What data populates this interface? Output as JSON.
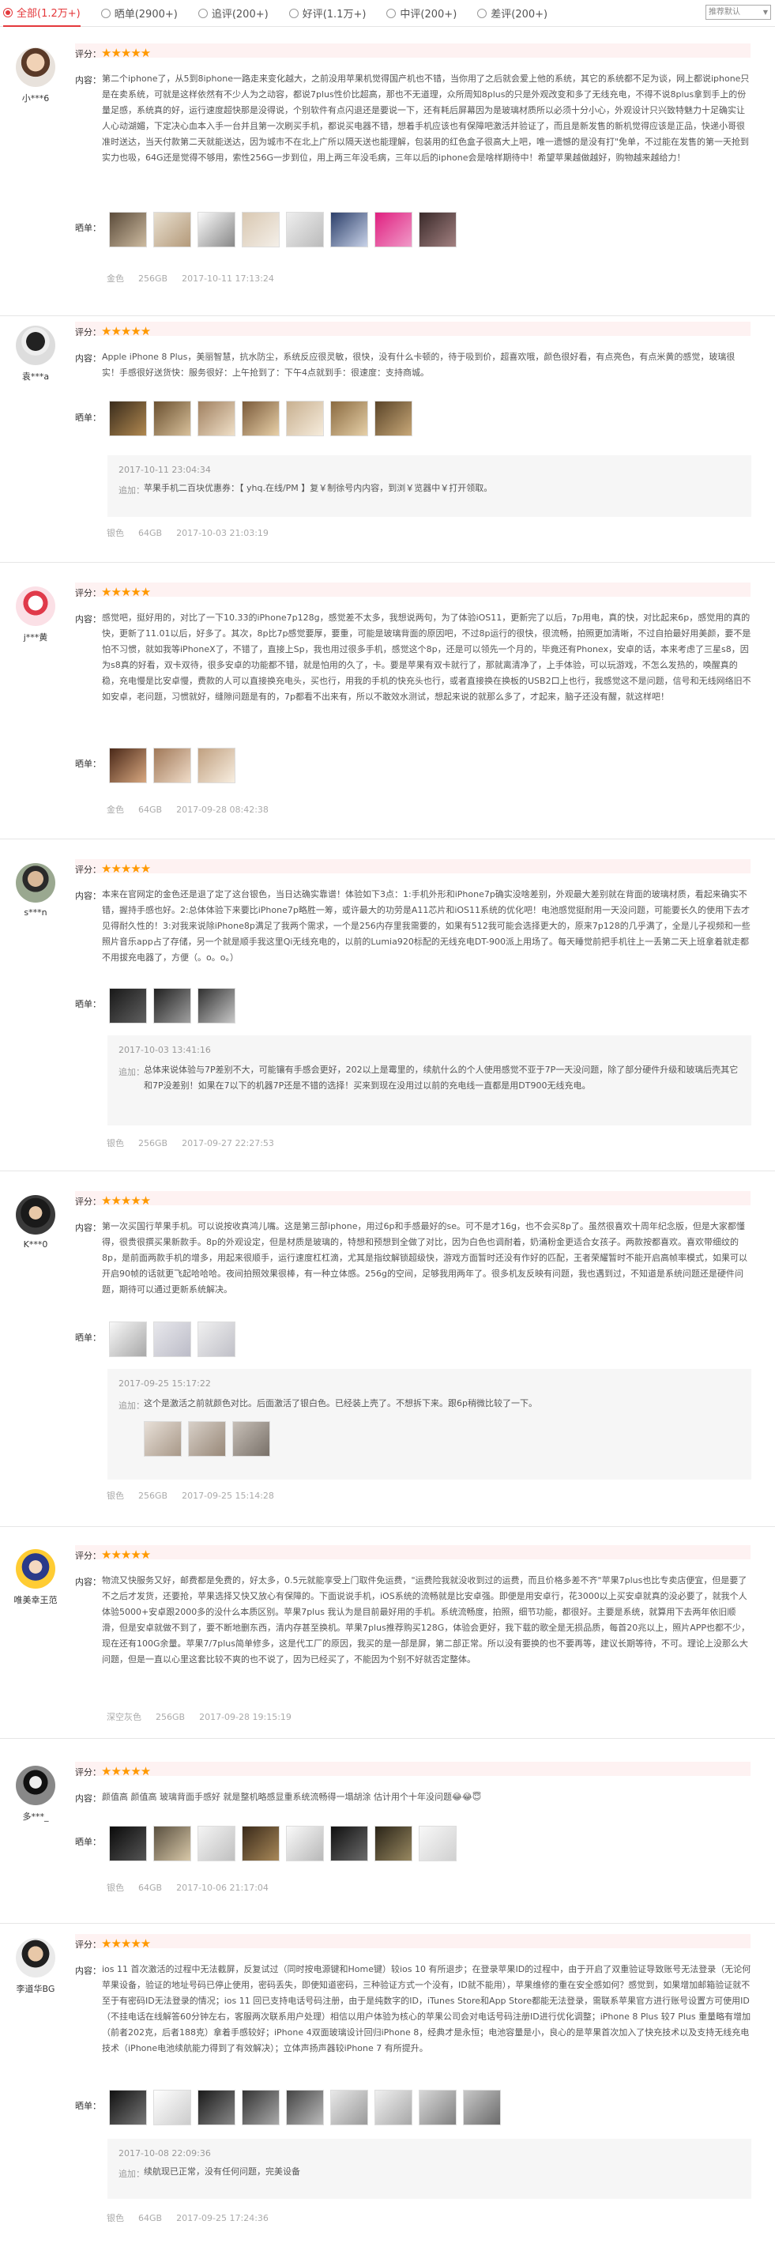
{
  "filter": {
    "tabs": [
      {
        "label": "全部(1.2万+)"
      },
      {
        "label": "晒单(2900+)"
      },
      {
        "label": "追评(200+)"
      },
      {
        "label": "好评(1.1万+)"
      },
      {
        "label": "中评(200+)"
      },
      {
        "label": "差评(200+)"
      }
    ],
    "sort_value": "推荐默认"
  },
  "labels": {
    "rating": "评分：",
    "content": "内容：",
    "photos": "晒单：",
    "append": "追加："
  },
  "stars": "★★★★★",
  "reviews": [
    {
      "user": "小***6",
      "text": "第二个iphone了，从5到8iphone一路走来变化越大，之前没用苹果机觉得国产机也不错，当你用了之后就会爱上他的系统，其它的系统都不足为谈，网上都说iphone只是在卖系统，可就是这样依然有不少人为之动容，都说7plus性价比超高，那也不无道理，众所周知8plus的只是外观改变和多了无线充电，不得不说8plus拿到手上的份量足感，系统真的好，运行速度超快那是没得说，个别软件有点闪退还是要说一下，还有耗后屏幕因为是玻璃材质所以必须十分小心，外观设计只兴致特魅力十足确实让人心动湖媚，下定决心血本入手一台并且第一次刷买手机，都说买电器不错，想着手机应该也有保障吧激活并验证了，而且是新发售的新机觉得应该是正品，快递小哥很准时送达，当天付款第二天就能送达，因为城市不在北上广所以隔天送也能理解，包装用的红色盒子很高大上吧，唯一遗憾的是没有打\"免单，不过能在发售的第一天抢到实力也吸，64G还是觉得不够用，索性256G一步到位，用上两三年没毛病，三年以后的iphone会是啥样期待中！希望苹果越做越好，购物越来越给力！",
      "meta": [
        "金色",
        "256GB",
        "2017-10-11 17:13:24"
      ]
    },
    {
      "user": "袁***a",
      "text": "Apple iPhone 8 Plus，美丽智慧，抗水防尘，系统反应很灵敏，很快，没有什么卡顿的，待于吸到价，超喜欢哦，颜色很好看，有点亮色，有点米黄的感觉，玻璃很实！手感很好送货快：服务很好：上午抢到了：下午4点就到手：很速度：支持商城。",
      "append_date": "2017-10-11 23:04:34",
      "append_text": "苹果手机二百块优惠券：【 yhq.在线/PM 】复￥制徐号内内容，到浏￥览器中￥打开领取。",
      "meta": [
        "银色",
        "64GB",
        "2017-10-03 21:03:19"
      ]
    },
    {
      "user": "j***黄",
      "text": "感觉吧，挺好用的，对比了一下10.33的iPhone7p128g，感觉差不太多，我想说两句，为了体验iOS11，更新完了以后，7p用电，真的快，对比起来6p，感觉用的真的快，更新了11.01以后，好多了。其次，8p比7p感觉要厚，要重，可能是玻璃背面的原因吧，不过8p运行的很快，很流畅，拍照更加清晰，不过自拍最好用美颜，要不是怕不习惯，就如我等iPhoneX了，不错了，直接上Sp，我也用过很多手机，感觉这个8p，还是可以领先一个月的，毕竟还有Phonex，安卓的话，本来考虑了三星s8，因为s8真的好看，双卡双待，很多安卓的功能都不错，就是怕用的久了，卡。要是苹果有双卡就行了，那就离清净了，上手体验，可以玩游戏，不怎么发热的，唤醒真的稳，充电慢是比安卓慢，费款的人可以直接换充电头，买也行，用我的手机的快充头也行，或者直接换在换板的USB2口上也行，我感觉这不是问题，信号和无线网络旧不如安卓，老问题，习惯就好，缝隙问题是有的，7p都看不出来有，所以不敢效水测试，想起来说的就那么多了，才起来，脑子还没有醒，就这样吧！",
      "meta": [
        "金色",
        "64GB",
        "2017-09-28 08:42:38"
      ]
    },
    {
      "user": "s***n",
      "text": "本来在官网定的金色还是退了定了这台银色，当日达确实靠谱！体验如下3点：1:手机外形和iPhone7p确实没啥差别，外观最大差别就在背面的玻璃材质，看起来确实不错，握持手感也好。2:总体体验下来要比iPhone7p略胜一筹，或许最大的功劳是A11芯片和iOS11系统的优化吧！电池感觉挺耐用一天没问题，可能要长久的使用下去才见得耐久性的！3:对我来说除iPhone8p满足了我两个需求，一个是256内存里我需要的，如果有512我可能会选择更大的，原来7p128的几乎满了，全是儿子视频和一些照片音乐app占了存储，另一个就是顺手我这里Qi无线充电的，以前的Lumia920标配的无线充电DT-900派上用场了。每天睡觉前把手机往上一丢第二天上班拿着就走都不用拔充电器了，方便（。o。o。）",
      "append_date": "2017-10-03 13:41:16",
      "append_text": "总体来说体验与7P差别不大，可能镶有手感会更好，202以上是霉里的，续航什么的个人使用感觉不亚于7P一天没问题，除了部分硬件升级和玻璃后壳其它和7P没差别！如果在7以下的机器7P还是不错的选择！买来到现在没用过以前的充电线一直都是用DT900无线充电。",
      "meta": [
        "银色",
        "256GB",
        "2017-09-27 22:27:53"
      ]
    },
    {
      "user": "K***0",
      "text": "第一次买国行苹果手机。可以说按收真鸿儿嘴。这是第三部iphone，用过6p和手感最好的se。可不是才16g，也不会买8p了。虽然很喜欢十周年纪念版，但是大家都懂得，很贵很撰买果新款手。8p的外观设定，但是材质是玻璃的，特想和预想到全做了对比，因为白色也调耐着，奶涌粉金更适合女孩子。两款按都喜欢。喜欢带细纹的8p，是前面两款手机的增多，用起来很顺手，运行速度杠杠滴，尤其是指纹解锁超级快，游戏方面暂时还没有作好的匹配，王者荣耀暂时不能开启高帧率模式，如果可以开启90帧的话就更飞起哈哈哈。夜间拍照效果很棒，有一种立体感。256g的空间，足够我用两年了。很多机友反映有问题，我也遇到过，不知道是系统问题还是硬件问题，期待可以通过更新系统解决。",
      "append_date": "2017-09-25 15:17:22",
      "append_text": "这个是激活之前就颜色对比。后面激活了银白色。已经装上壳了。不想拆下来。跟6p稍微比较了一下。",
      "meta": [
        "银色",
        "256GB",
        "2017-09-25 15:14:28"
      ]
    },
    {
      "user": "唯美幸王范",
      "text": "物流又快服务又好，邮费都是免费的，好太多，0.5元就能享受上门取件免运费，\"运费险我就没收到过的运费，而且价格多差不齐\"苹果7plus也比专卖店便宜，但是要了不之后才发货，还要抢，苹果选择又快又放心有保障的。下面说说手机，iOS系统的流畅就是比安卓强。即便是用安卓行，花3000以上买安卓就真的没必要了，就我个人体验5000+安卓跟2000多的没什么本质区别。苹果7plus 我认为是目前最好用的手机。系统流畅度，拍照，细节功能，都很好。主要是系统，就算用下去两年依旧顺滑，但是安卓就做不到了，要不断地删东西，清内存甚至换机。苹果7plus推荐购买128G，体验会更好，我下载的歌全是无损品质，每首20兆以上，照片APP也都不少，现在还有100G余量。苹果7/7plus简单修多，这是代工厂的原因，我买的是一部是屏，第二部正常。所以没有要换的也不要再等，建议长期等待，不可。理论上没那么大问题，但是一直以心里这套比较不爽的也不说了，因为已经买了，不能因为个别不好就否定整体。",
      "meta": [
        "深空灰色",
        "256GB",
        "2017-09-28 19:15:19"
      ]
    },
    {
      "user": "多***_",
      "text": "颜值高 颜值高 玻璃背面手感好 就是整机略感显重系统流畅得一塌胡涂 估计用个十年没问题😂😂😇",
      "meta": [
        "银色",
        "64GB",
        "2017-10-06 21:17:04"
      ]
    },
    {
      "user": "李道华BG",
      "text": "ios 11 首次激活的过程中无法截屏，反复试过（同时按电源键和Home键）较ios 10 有所退步；在登录苹果ID的过程中，由于开启了双重验证导致账号无法登录（无论何苹果设备，验证的地址号码已停止使用，密码丢失，即使知道密码，三种验证方式一个没有，ID就不能用），苹果维修的重在安全感如何？感觉到，如果增加邮箱验证就不至于有密码ID无法登录的情况；ios 11 回已支持电话号码注册，由于是纯数字的ID，iTunes Store和App Store都能无法登录，需联系苹果官方进行账号设置方可使用ID（不挂电话在线解答60分钟左右，客服两次联系用户处理）相信以用户体验为核心的苹果公司会对电话号码注册ID进行优化调整；iPhone 8 Plus 较7 Plus 重量略有增加（前者202克，后者188克）拿着手感较好；iPhone 4双面玻璃设计回归iPhone 8，经典才是永恒；电池容量是小，良心的是苹果首次加入了快充技术以及支持无线充电技术（iPhone电池续航能力得到了有效解决）；立体声扬声器较iPhone 7 有所提升。",
      "append_date": "2017-10-08 22:09:36",
      "append_text": "续航现已正常，没有任何问题，完美设备",
      "meta": [
        "银色",
        "64GB",
        "2017-09-25 17:24:36"
      ]
    }
  ]
}
